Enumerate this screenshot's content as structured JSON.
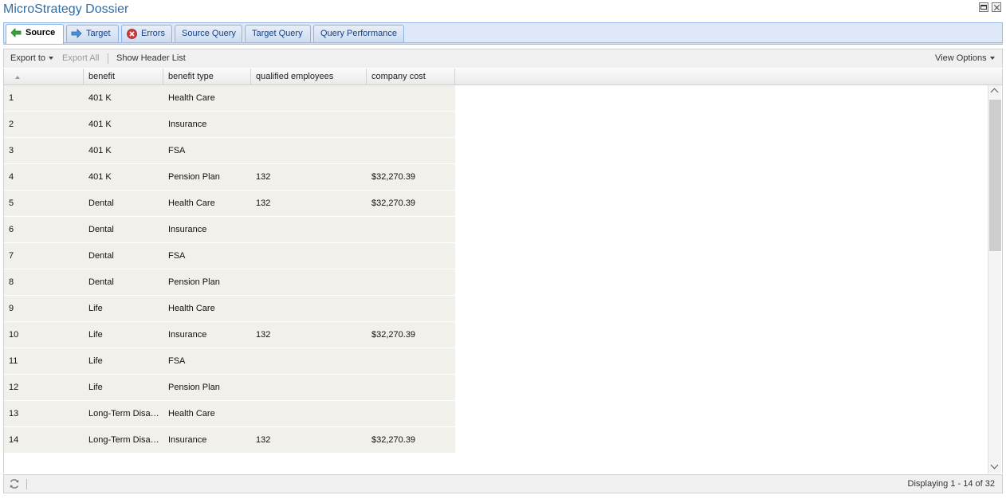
{
  "window": {
    "title": "MicroStrategy Dossier"
  },
  "tabs": [
    {
      "label": "Source",
      "icon": "arrow-left-icon",
      "active": true
    },
    {
      "label": "Target",
      "icon": "arrow-right-icon"
    },
    {
      "label": "Errors",
      "icon": "error-icon"
    },
    {
      "label": "Source Query"
    },
    {
      "label": "Target Query"
    },
    {
      "label": "Query Performance"
    }
  ],
  "toolbar": {
    "export_to": "Export to",
    "export_all": "Export All",
    "show_header_list": "Show Header List",
    "view_options": "View Options"
  },
  "grid": {
    "columns": [
      "",
      "benefit",
      "benefit type",
      "qualified employees",
      "company cost"
    ],
    "rows": [
      [
        "1",
        "401 K",
        "Health Care",
        "",
        ""
      ],
      [
        "2",
        "401 K",
        "Insurance",
        "",
        ""
      ],
      [
        "3",
        "401 K",
        "FSA",
        "",
        ""
      ],
      [
        "4",
        "401 K",
        "Pension Plan",
        "132",
        "$32,270.39"
      ],
      [
        "5",
        "Dental",
        "Health Care",
        "132",
        "$32,270.39"
      ],
      [
        "6",
        "Dental",
        "Insurance",
        "",
        ""
      ],
      [
        "7",
        "Dental",
        "FSA",
        "",
        ""
      ],
      [
        "8",
        "Dental",
        "Pension Plan",
        "",
        ""
      ],
      [
        "9",
        "Life",
        "Health Care",
        "",
        ""
      ],
      [
        "10",
        "Life",
        "Insurance",
        "132",
        "$32,270.39"
      ],
      [
        "11",
        "Life",
        "FSA",
        "",
        ""
      ],
      [
        "12",
        "Life",
        "Pension Plan",
        "",
        ""
      ],
      [
        "13",
        "Long-Term Disa…",
        "Health Care",
        "",
        ""
      ],
      [
        "14",
        "Long-Term Disa…",
        "Insurance",
        "132",
        "$32,270.39"
      ]
    ]
  },
  "status": {
    "display": "Displaying 1 - 14 of 32"
  },
  "colors": {
    "title": "#2f6fa7",
    "row_bg": "#f1f0eb",
    "tab_border": "#99bbe8"
  }
}
